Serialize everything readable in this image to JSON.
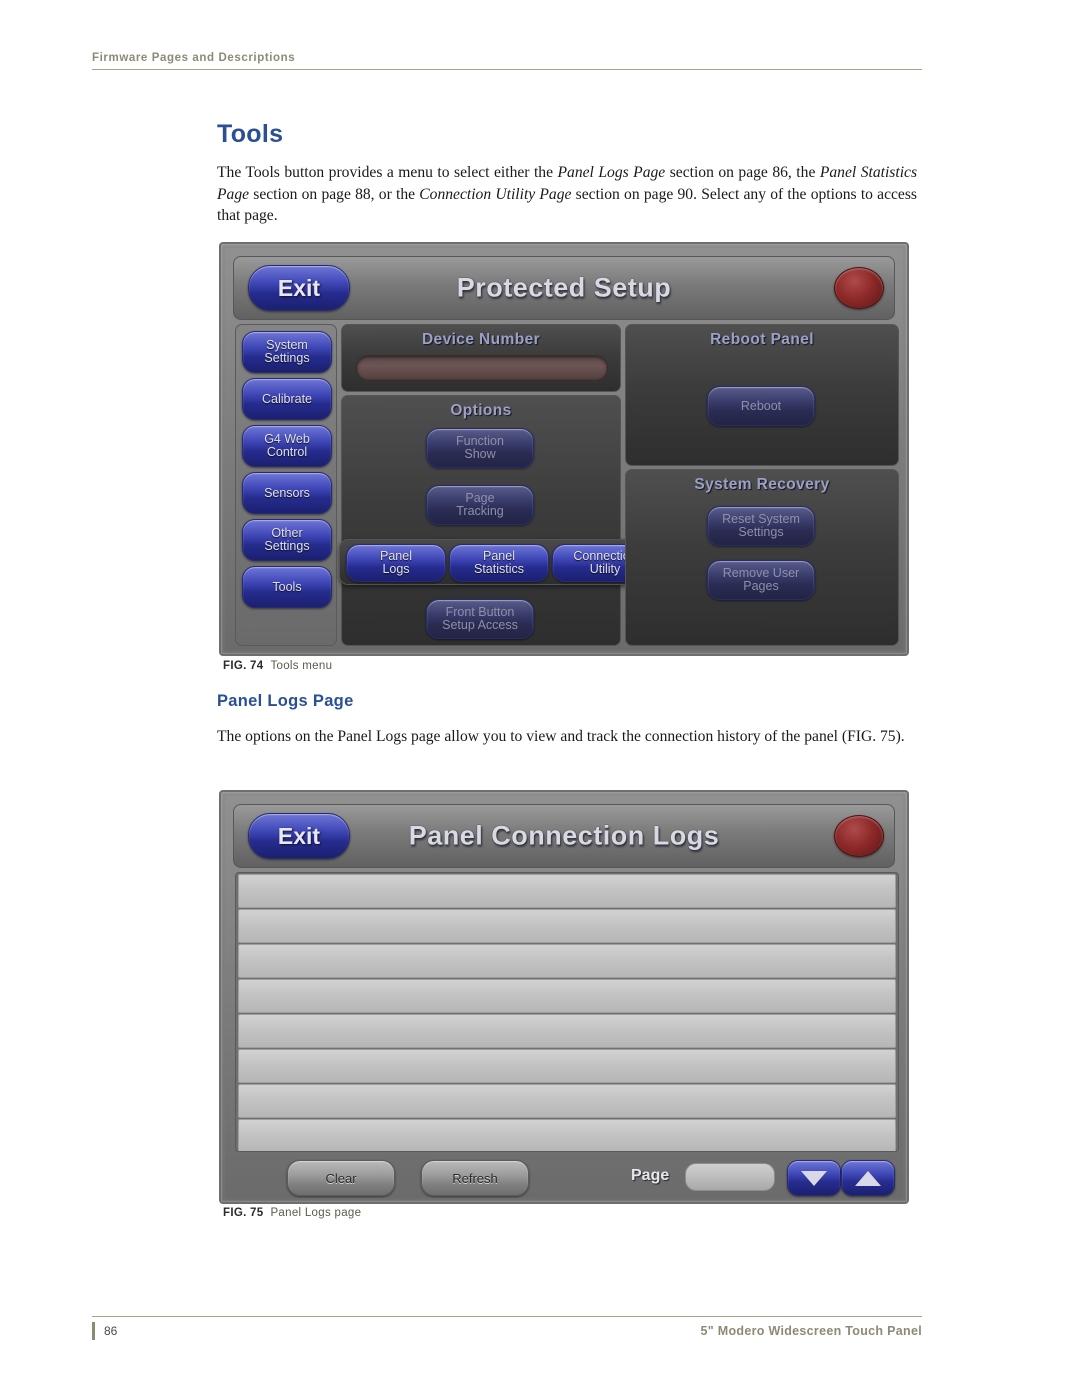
{
  "header": {
    "running_head": "Firmware Pages and Descriptions"
  },
  "footer": {
    "page_number": "86",
    "doc_title": "5\" Modero Widescreen Touch Panel"
  },
  "section": {
    "title": "Tools",
    "paragraph": "The Tools button provides a menu to select either the Panel Logs Page section on page 86, the Panel Statistics Page section on page 88, or the Connection Utility Page section on page 90. Select any of the options to access that page.",
    "para_runs": [
      {
        "text": "The Tools button provides a menu to select either the ",
        "style": "normal"
      },
      {
        "text": "Panel Logs Page",
        "style": "italic"
      },
      {
        "text": " section on page 86, the ",
        "style": "normal"
      },
      {
        "text": "Panel Statistics Page",
        "style": "italic"
      },
      {
        "text": " section on page 88, or the ",
        "style": "normal"
      },
      {
        "text": "Connection Utility Page",
        "style": "italic"
      },
      {
        "text": " section on page 90. Select any of the options to access that page.",
        "style": "normal"
      }
    ]
  },
  "figure_74": {
    "label": "FIG. 74",
    "caption": "Tools menu",
    "panel": {
      "title": "Protected Setup",
      "exit_label": "Exit",
      "close_icon": "close-circle-icon",
      "sidebar": [
        {
          "label": "System\nSettings",
          "line1": "System",
          "line2": "Settings",
          "state": "enabled"
        },
        {
          "label": "Calibrate",
          "line1": "Calibrate",
          "line2": "",
          "state": "enabled"
        },
        {
          "label": "G4 Web Control",
          "line1": "G4 Web",
          "line2": "Control",
          "state": "enabled"
        },
        {
          "label": "Sensors",
          "line1": "Sensors",
          "line2": "",
          "state": "enabled"
        },
        {
          "label": "Other Settings",
          "line1": "Other",
          "line2": "Settings",
          "state": "enabled"
        },
        {
          "label": "Tools",
          "line1": "Tools",
          "line2": "",
          "state": "enabled"
        }
      ],
      "device_number": {
        "group_label": "Device Number",
        "value": ""
      },
      "options": {
        "group_label": "Options",
        "buttons": [
          {
            "line1": "Function",
            "line2": "Show",
            "state": "dim"
          },
          {
            "line1": "Page",
            "line2": "Tracking",
            "state": "dim"
          },
          {
            "line1": "Front Button",
            "line2": "Setup Access",
            "state": "dim"
          }
        ]
      },
      "tools_menu": [
        {
          "line1": "Panel",
          "line2": "Logs",
          "state": "enabled"
        },
        {
          "line1": "Panel",
          "line2": "Statistics",
          "state": "enabled"
        },
        {
          "line1": "Connection",
          "line2": "Utility",
          "state": "enabled"
        }
      ],
      "reboot_panel": {
        "group_label": "Reboot Panel",
        "button": {
          "line1": "Reboot",
          "line2": "",
          "state": "dim"
        }
      },
      "system_recovery": {
        "group_label": "System Recovery",
        "buttons": [
          {
            "line1": "Reset System",
            "line2": "Settings",
            "state": "dim"
          },
          {
            "line1": "Remove User",
            "line2": "Pages",
            "state": "dim"
          }
        ]
      }
    }
  },
  "subsection": {
    "title": "Panel Logs Page",
    "paragraph": "The options on the Panel Logs page allow you to view and track the connection history of the panel (FIG. 75)."
  },
  "figure_75": {
    "label": "FIG. 75",
    "caption": "Panel Logs page",
    "panel": {
      "title": "Panel Connection Logs",
      "exit_label": "Exit",
      "close_icon": "close-circle-icon",
      "log_rows": [
        "",
        "",
        "",
        "",
        "",
        "",
        "",
        "",
        ""
      ],
      "clear_label": "Clear",
      "refresh_label": "Refresh",
      "page_label": "Page",
      "page_value": "",
      "down_icon": "triangle-down-icon",
      "up_icon": "triangle-up-icon"
    }
  },
  "colors": {
    "heading_blue": "#2a4f94",
    "rule_olive": "#a8a386",
    "button_blue": "#4048b8",
    "close_red": "#8e2a2a"
  }
}
